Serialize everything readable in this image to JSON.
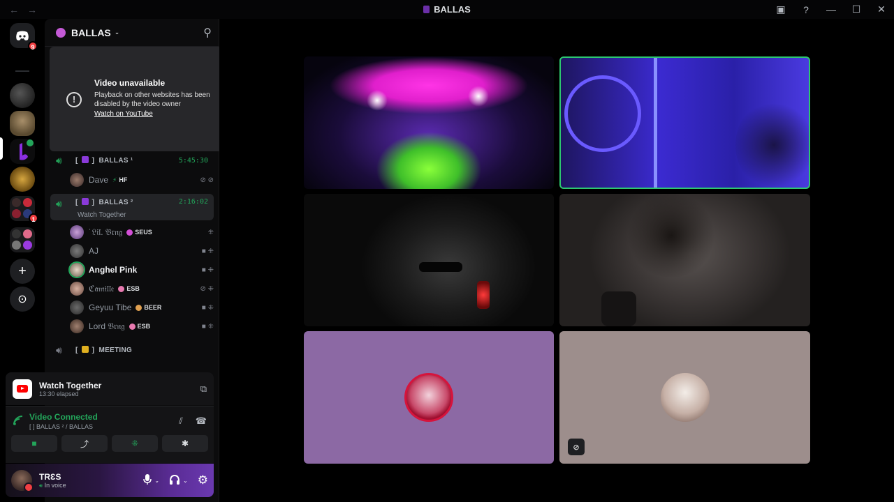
{
  "titlebar": {
    "title": "BALLAS",
    "back_icon": "←",
    "forward_icon": "→",
    "buttons": [
      {
        "name": "inbox-icon",
        "glyph": "▣"
      },
      {
        "name": "help-icon",
        "glyph": "?"
      },
      {
        "name": "minimize-icon",
        "glyph": "—"
      },
      {
        "name": "maximize-icon",
        "glyph": "☐"
      },
      {
        "name": "close-icon",
        "glyph": "✕"
      }
    ]
  },
  "rail": {
    "home_badge": "9",
    "group_badge": "1",
    "add_glyph": "+",
    "discover_glyph": "⊙"
  },
  "guild": {
    "name": "BALLAS",
    "caret": "⌄",
    "invite_glyph": "⚲"
  },
  "popup": {
    "alert_glyph": "!",
    "title": "Video unavailable",
    "message": "Playback on other websites has been disabled by the video owner",
    "link": "Watch on YouTube"
  },
  "channels": [
    {
      "bracket_left": "[",
      "bracket_right": "]",
      "name": "BALLAS ¹",
      "time": "5:45:30"
    },
    {
      "bracket_left": "[",
      "bracket_right": "]",
      "name": "BALLAS ²",
      "time": "2:16:02",
      "subtitle": "Watch Together"
    },
    {
      "bracket_left": "[",
      "bracket_right": "]",
      "name": "MEETING"
    }
  ],
  "members_c1": [
    {
      "name": "Dave",
      "tag": "HF",
      "icons": "⊘ ⊘"
    }
  ],
  "members_c2": [
    {
      "name": "˙𝔏𝔦𝔩. 𝔅𝔯𝔫𝔤",
      "tag": "SEUS",
      "icons": "⁜"
    },
    {
      "name": "AJ",
      "tag": "",
      "icons": "■ ⁜"
    },
    {
      "name": "Anghel Pink",
      "tag": "",
      "icons": "■ ⁜"
    },
    {
      "name": "ℭ𝔞𝔪𝔦𝔩𝔩𝔢",
      "tag": "ESB",
      "icons": "⊘ ⁜"
    },
    {
      "name": "Geyuu Tibe",
      "tag": "BEER",
      "icons": "■ ⁜"
    },
    {
      "name": "Lord 𝔅𝔯𝔫𝔤",
      "tag": "ESB",
      "icons": "■ ⁜"
    }
  ],
  "activity": {
    "title": "Watch Together",
    "elapsed": "13:30 elapsed",
    "popout_glyph": "⧉"
  },
  "voice": {
    "status": "Video Connected",
    "channel": "[ ] BALLAS ² / BALLAS",
    "noise_glyph": "⫽",
    "disconnect_glyph": "☎",
    "buttons": [
      {
        "name": "camera-button",
        "glyph": "■",
        "color": "#23a55a"
      },
      {
        "name": "screenshare-button",
        "glyph": "⤴",
        "color": "#dbdee1"
      },
      {
        "name": "activities-button",
        "glyph": "⁜",
        "color": "#23a55a"
      },
      {
        "name": "soundboard-button",
        "glyph": "✱",
        "color": "#dbdee1"
      }
    ]
  },
  "user": {
    "name": "TRƐS",
    "status": "In voice",
    "mic_glyph": "🎤",
    "headset_glyph": "🎧",
    "settings_glyph": "⚙",
    "caret": "⌄"
  },
  "tiles": {
    "mute_glyph": "⊘"
  }
}
